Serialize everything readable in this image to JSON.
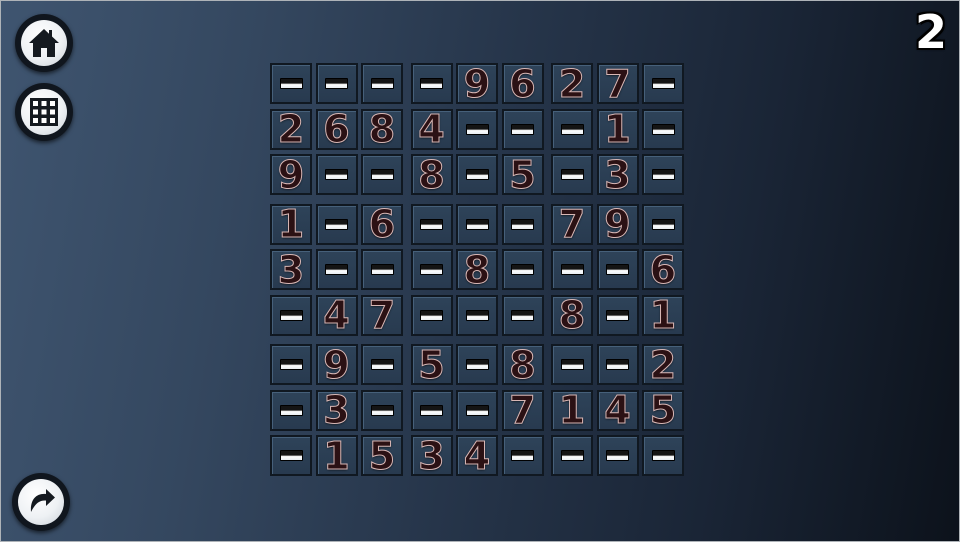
{
  "level": "2",
  "buttons": {
    "home_icon": "home-icon",
    "levels_icon": "grid-icon",
    "restart_icon": "rotate-icon"
  },
  "grid": [
    [
      "",
      "",
      "",
      "",
      "9",
      "6",
      "2",
      "7",
      ""
    ],
    [
      "2",
      "6",
      "8",
      "4",
      "",
      "",
      "",
      "1",
      ""
    ],
    [
      "9",
      "",
      "",
      "8",
      "",
      "5",
      "",
      "3",
      ""
    ],
    [
      "1",
      "",
      "6",
      "",
      "",
      "",
      "7",
      "9",
      ""
    ],
    [
      "3",
      "",
      "",
      "",
      "8",
      "",
      "",
      "",
      "6"
    ],
    [
      "",
      "4",
      "7",
      "",
      "",
      "",
      "8",
      "",
      "1"
    ],
    [
      "",
      "9",
      "",
      "5",
      "",
      "8",
      "",
      "",
      "2"
    ],
    [
      "",
      "3",
      "",
      "",
      "",
      "7",
      "1",
      "4",
      "5"
    ],
    [
      "",
      "1",
      "5",
      "3",
      "4",
      "",
      "",
      "",
      ""
    ]
  ],
  "colors": {
    "cell_bg": "#2e4359",
    "digit_fill": "#2b1114",
    "digit_outline": "#d8b7b5",
    "button_face": "#ffffff"
  }
}
